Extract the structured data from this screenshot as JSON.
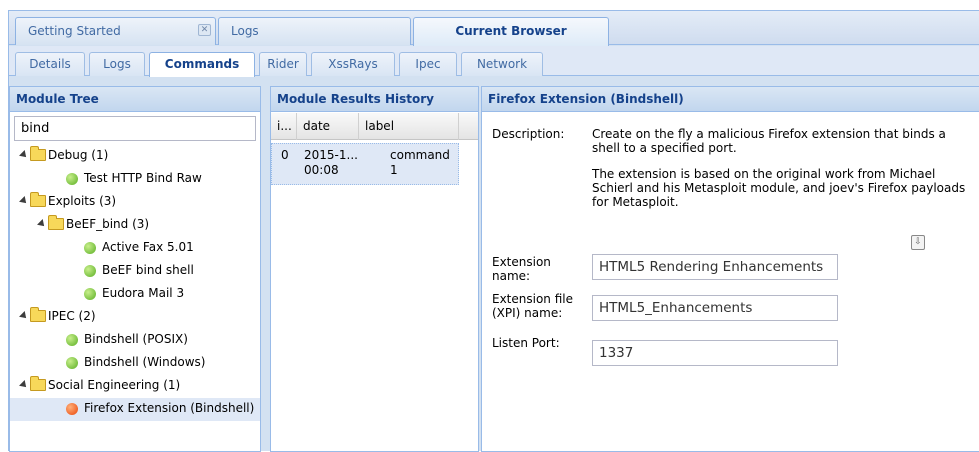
{
  "top_tabs": [
    {
      "label": "Getting Started",
      "closable": true
    },
    {
      "label": "Logs"
    },
    {
      "label": "Current Browser",
      "active": true
    }
  ],
  "sub_tabs": [
    {
      "label": "Details"
    },
    {
      "label": "Logs"
    },
    {
      "label": "Commands",
      "active": true
    },
    {
      "label": "Rider"
    },
    {
      "label": "XssRays"
    },
    {
      "label": "Ipec"
    },
    {
      "label": "Network"
    }
  ],
  "module_tree": {
    "title": "Module Tree",
    "search_value": "bind",
    "nodes": [
      {
        "label": "Debug (1)",
        "type": "folder"
      },
      {
        "label": "Test HTTP Bind Raw",
        "type": "module",
        "status": "green"
      },
      {
        "label": "Exploits (3)",
        "type": "folder"
      },
      {
        "label": "BeEF_bind (3)",
        "type": "folder"
      },
      {
        "label": "Active Fax 5.01",
        "type": "module",
        "status": "green"
      },
      {
        "label": "BeEF bind shell",
        "type": "module",
        "status": "green"
      },
      {
        "label": "Eudora Mail 3",
        "type": "module",
        "status": "green"
      },
      {
        "label": "IPEC (2)",
        "type": "folder"
      },
      {
        "label": "Bindshell (POSIX)",
        "type": "module",
        "status": "green"
      },
      {
        "label": "Bindshell (Windows)",
        "type": "module",
        "status": "green"
      },
      {
        "label": "Social Engineering (1)",
        "type": "folder"
      },
      {
        "label": "Firefox Extension (Bindshell)",
        "type": "module",
        "status": "orange",
        "selected": true
      }
    ]
  },
  "results_history": {
    "title": "Module Results History",
    "columns": [
      "i...",
      "date",
      "label"
    ],
    "rows": [
      {
        "id": "0",
        "date_line1": "2015-1...",
        "date_line2": "00:08",
        "label_line1": "command",
        "label_line2": "1"
      }
    ]
  },
  "details": {
    "title": "Firefox Extension (Bindshell)",
    "description_label": "Description:",
    "description_p1_line1": "Create on the fly a malicious Firefox extension that binds a",
    "description_p1_line2": "shell to a specified port.",
    "description_p2_line1": "The extension is based on the original work from Michael",
    "description_p2_line2": "Schierl and his Metasploit module, and joev's Firefox payloads",
    "description_p2_line3": "for Metasploit.",
    "fields": {
      "extension_name_label_1": "Extension",
      "extension_name_label_2": "name:",
      "extension_name_value": "HTML5 Rendering Enhancements",
      "xpi_name_label_1": "Extension file",
      "xpi_name_label_2": "(XPI) name:",
      "xpi_name_value": "HTML5_Enhancements",
      "listen_port_label": "Listen Port:",
      "listen_port_value": "1337"
    }
  },
  "colors": {
    "accent": "#15428b",
    "border": "#99bbe8",
    "selection": "#dfe8f6",
    "status_green": "#7ac142",
    "status_orange": "#f0652a"
  }
}
